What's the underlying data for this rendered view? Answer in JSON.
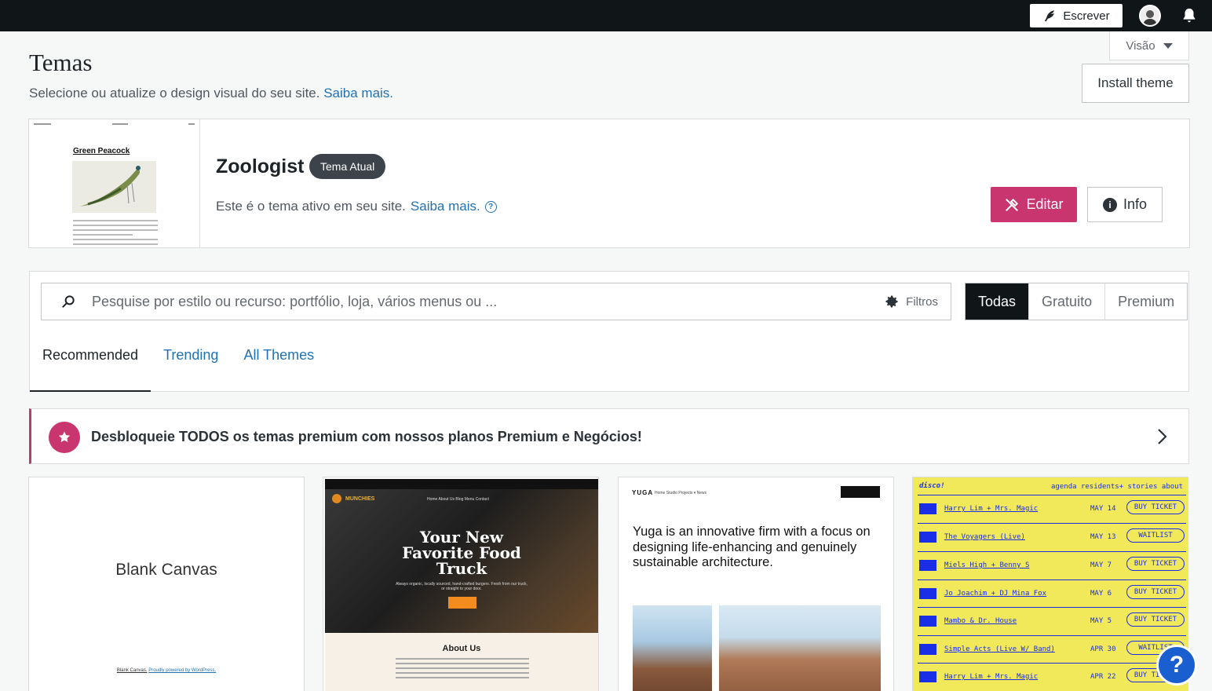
{
  "topbar": {
    "write_label": "Escrever"
  },
  "header": {
    "title": "Temas",
    "subtitle": "Selecione ou atualize o design visual do seu site.",
    "learn_more": "Saiba mais.",
    "view_label": "Visão",
    "install_label": "Install theme"
  },
  "current_theme": {
    "name": "Zoologist",
    "badge": "Tema Atual",
    "description": "Este é o tema ativo em seu site.",
    "learn_more": "Saiba mais.",
    "preview_title": "Green Peacock",
    "edit_label": "Editar",
    "info_label": "Info"
  },
  "search": {
    "placeholder": "Pesquise por estilo ou recurso: portfólio, loja, vários menus ou ...",
    "filters_label": "Filtros",
    "segments": [
      "Todas",
      "Gratuito",
      "Premium"
    ],
    "active_segment": "Todas"
  },
  "tabs": [
    {
      "label": "Recommended",
      "active": true
    },
    {
      "label": "Trending",
      "active": false
    },
    {
      "label": "All Themes",
      "active": false
    }
  ],
  "upsell": {
    "text": "Desbloqueie TODOS os temas premium com nossos planos Premium e Negócios!"
  },
  "themes": {
    "blank": {
      "title": "Blank Canvas",
      "footer_link": "Blank Canvas.",
      "footer_text": "Proudly powered by WordPress."
    },
    "food": {
      "brand": "MUNCHIES",
      "nav": "Home   About Us   Blog   Menu   Contact",
      "headline": "Your New Favorite Food Truck",
      "tagline": "Always organic, locally sourced, hand-crafted burgers. Fresh from our truck, or straight to your door.",
      "about": "About Us"
    },
    "yuga": {
      "brand": "YUGA",
      "nav": "Home   Studio   Projects ▾   News",
      "headline": "Yuga is an innovative firm with a focus on designing life-enhancing and genuinely sustainable architecture."
    },
    "disco": {
      "brand": "disco!",
      "nav": "agenda   residents+   stories   about",
      "rows": [
        {
          "name": "Harry Lim + Mrs. Magic",
          "date": "MAY 14",
          "ticket": "BUY TICKET"
        },
        {
          "name": "The Voyagers (Live)",
          "date": "MAY 13",
          "ticket": "WAITLIST"
        },
        {
          "name": "Miels High + Benny S",
          "date": "MAY 7",
          "ticket": "BUY TICKET"
        },
        {
          "name": "Jo Joachim + DJ Mina Fox",
          "date": "MAY 6",
          "ticket": "BUY TICKET"
        },
        {
          "name": "Mambo & Dr. House",
          "date": "MAY 5",
          "ticket": "BUY TICKET"
        },
        {
          "name": "Simple Acts (Live W/ Band)",
          "date": "APR 30",
          "ticket": "WAITLIST"
        },
        {
          "name": "Harry Lim + Mrs. Magic",
          "date": "APR 22",
          "ticket": "BUY TICKET"
        }
      ]
    }
  },
  "help": {
    "label": "?"
  },
  "colors": {
    "accent_pink": "#c9356e",
    "link_blue": "#2271b1",
    "dark": "#101517"
  }
}
